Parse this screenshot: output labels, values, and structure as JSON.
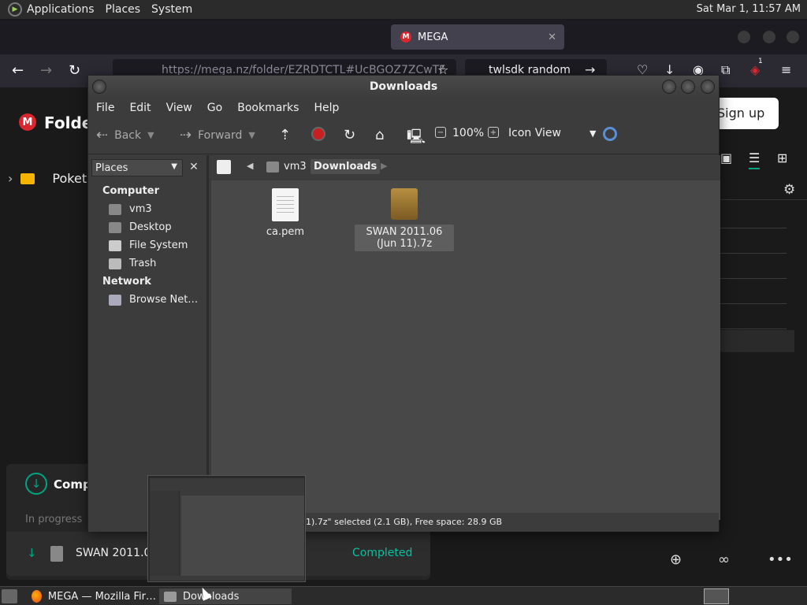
{
  "top_panel": {
    "menus": [
      "Applications",
      "Places",
      "System"
    ],
    "clock": "Sat Mar  1, 11:57 AM"
  },
  "firefox": {
    "active_tab_title": "MEGA",
    "url": "https://mega.nz/folder/EZRDTCTL#UcBGOZ7ZCwTF",
    "search_text": "twlsdk random",
    "badge_count": "1"
  },
  "mega": {
    "logo_letter": "M",
    "folder_title": "Folde",
    "signup_label": "Sign up",
    "tree_item": "Poket",
    "transfers": {
      "title": "Compl",
      "in_progress_label": "In progress",
      "file_name": "SWAN 2011.06",
      "status": "Completed"
    }
  },
  "nautilus": {
    "title": "Downloads",
    "menus": [
      "File",
      "Edit",
      "View",
      "Go",
      "Bookmarks",
      "Help"
    ],
    "toolbar": {
      "back": "Back",
      "forward": "Forward",
      "zoom": "100%",
      "view_mode": "Icon View"
    },
    "sidebar": {
      "combo": "Places",
      "computer_header": "Computer",
      "computer_items": [
        "vm3",
        "Desktop",
        "File System",
        "Trash"
      ],
      "network_header": "Network",
      "network_items": [
        "Browse Net…"
      ]
    },
    "path": [
      "vm3",
      "Downloads"
    ],
    "files": [
      {
        "name": "ca.pem"
      },
      {
        "name": "SWAN 2011.06 (Jun 11).7z"
      }
    ],
    "status": "1).7z\" selected (2.1 GB), Free space: 28.9 GB"
  },
  "taskbar": {
    "tasks": [
      "MEGA — Mozilla Fir…",
      "Downloads"
    ]
  }
}
